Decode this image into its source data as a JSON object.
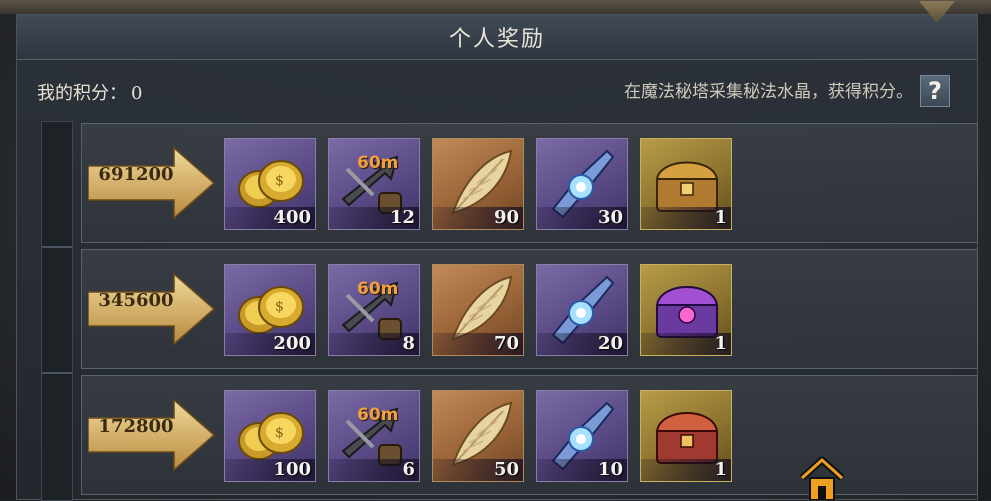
{
  "header": {
    "title": "个人奖励"
  },
  "score": {
    "label": "我的积分：",
    "value": "0"
  },
  "hint": "在魔法秘塔采集秘法水晶，获得积分。",
  "help_icon": "?",
  "colors": {
    "accent_gold": "#c8a45a",
    "purple_slot": "#5a4a86",
    "orange_slot": "#9a6438"
  },
  "tiers": [
    {
      "threshold": "691200",
      "rewards": [
        {
          "icon": "gold-coins-icon",
          "qty": "400"
        },
        {
          "icon": "timed-arrow-buff-icon",
          "qty": "12",
          "duration": "60m"
        },
        {
          "icon": "golden-feather-icon",
          "qty": "90"
        },
        {
          "icon": "crystal-shard-icon",
          "qty": "30"
        },
        {
          "icon": "gold-treasure-chest-icon",
          "qty": "1"
        }
      ]
    },
    {
      "threshold": "345600",
      "rewards": [
        {
          "icon": "gold-coins-icon",
          "qty": "200"
        },
        {
          "icon": "timed-arrow-buff-icon",
          "qty": "8",
          "duration": "60m"
        },
        {
          "icon": "golden-feather-icon",
          "qty": "70"
        },
        {
          "icon": "crystal-shard-icon",
          "qty": "20"
        },
        {
          "icon": "purple-treasure-chest-icon",
          "qty": "1"
        }
      ]
    },
    {
      "threshold": "172800",
      "rewards": [
        {
          "icon": "gold-coins-icon",
          "qty": "100"
        },
        {
          "icon": "timed-arrow-buff-icon",
          "qty": "6",
          "duration": "60m"
        },
        {
          "icon": "golden-feather-icon",
          "qty": "50"
        },
        {
          "icon": "crystal-shard-icon",
          "qty": "10"
        },
        {
          "icon": "red-treasure-chest-icon",
          "qty": "1"
        }
      ]
    }
  ]
}
